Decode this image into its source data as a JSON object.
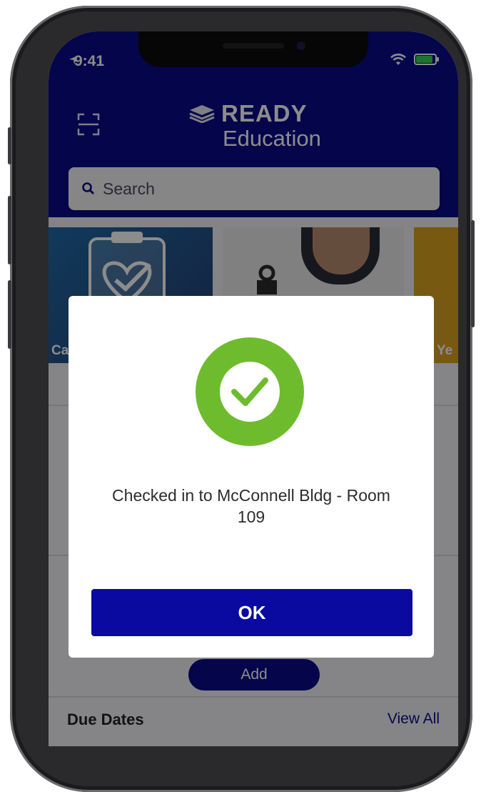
{
  "status_bar": {
    "time": "9:41"
  },
  "header": {
    "brand": "READY",
    "subtitle": "Education"
  },
  "search": {
    "placeholder": "Search"
  },
  "cards": [
    {
      "label": "Ca"
    },
    {
      "label": ""
    },
    {
      "label": "Ye"
    }
  ],
  "background": {
    "add_label": "Add",
    "due_dates_label": "Due Dates",
    "view_all_label": "View All"
  },
  "modal": {
    "message": "Checked in to McConnell Bldg - Room 109",
    "ok_label": "OK"
  },
  "colors": {
    "primary": "#0a0a8a",
    "success": "#6ebc2d",
    "button": "#0a0aa0"
  }
}
